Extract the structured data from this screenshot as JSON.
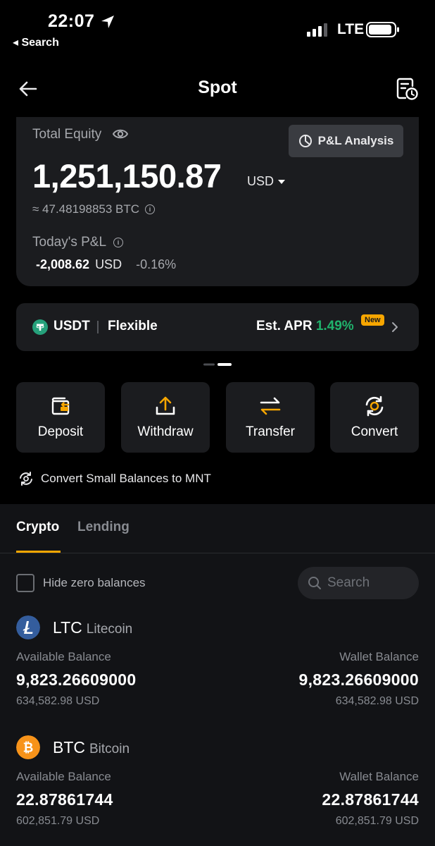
{
  "status_bar": {
    "time": "22:07",
    "back_label": "◂ Search",
    "network": "LTE"
  },
  "header": {
    "title": "Spot"
  },
  "equity": {
    "label": "Total Equity",
    "value": "1,251,150.87",
    "currency": "USD",
    "btc_equivalent": "≈ 47.48198853 BTC",
    "pl_button": "P&L Analysis",
    "today_pl_label": "Today's P&L",
    "today_pl_value": "-2,008.62",
    "today_pl_currency": "USD",
    "today_pl_pct": "-0.16%"
  },
  "banner": {
    "coin": "USDT",
    "product": "Flexible",
    "apr_label": "Est. APR",
    "apr_value": "1.49%",
    "badge": "New"
  },
  "actions": [
    {
      "label": "Deposit",
      "icon": "wallet-deposit-icon"
    },
    {
      "label": "Withdraw",
      "icon": "upload-icon"
    },
    {
      "label": "Transfer",
      "icon": "swap-arrows-icon"
    },
    {
      "label": "Convert",
      "icon": "convert-cycle-icon"
    }
  ],
  "convert_small": "Convert Small Balances to MNT",
  "tabs": [
    {
      "label": "Crypto",
      "active": true
    },
    {
      "label": "Lending",
      "active": false
    }
  ],
  "filters": {
    "hide_zero_label": "Hide zero balances",
    "search_placeholder": "Search"
  },
  "assets": [
    {
      "symbol": "LTC",
      "name": "Litecoin",
      "available_label": "Available Balance",
      "available": "9,823.26609000",
      "available_usd": "634,582.98 USD",
      "wallet_label": "Wallet Balance",
      "wallet": "9,823.26609000",
      "wallet_usd": "634,582.98 USD",
      "icon_color": "#345d9d"
    },
    {
      "symbol": "BTC",
      "name": "Bitcoin",
      "available_label": "Available Balance",
      "available": "22.87861744",
      "available_usd": "602,851.79 USD",
      "wallet_label": "Wallet Balance",
      "wallet": "22.87861744",
      "wallet_usd": "602,851.79 USD",
      "icon_color": "#f7931a"
    }
  ],
  "colors": {
    "accent": "#f7a600",
    "positive": "#20b26c",
    "card": "#1b1c1f"
  }
}
